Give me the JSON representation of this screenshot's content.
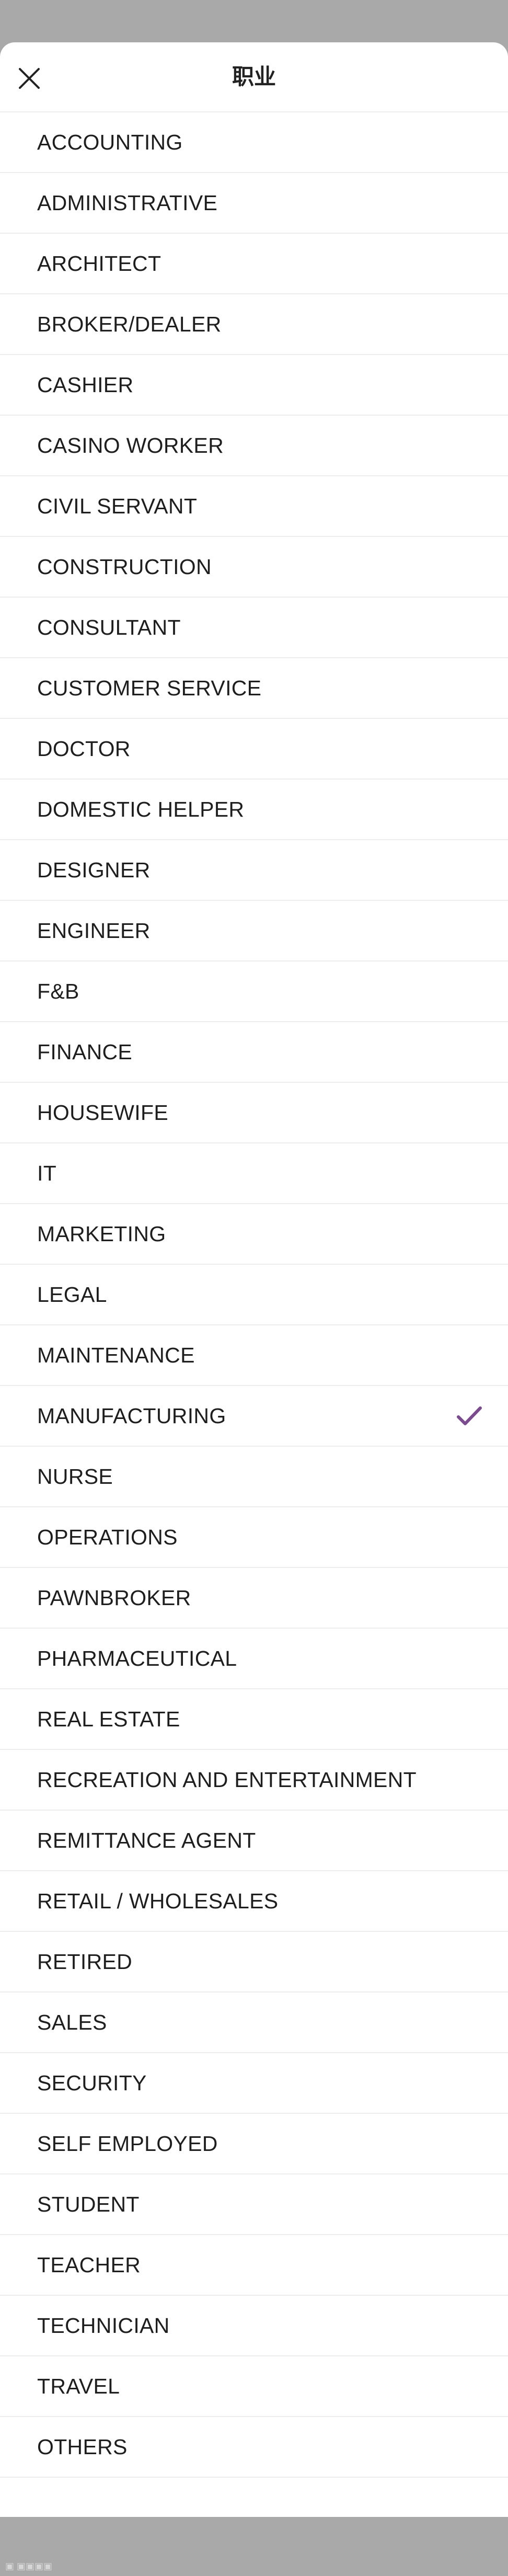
{
  "header": {
    "title": "职业",
    "close_icon": "close-icon"
  },
  "occupations": [
    {
      "label": "ACCOUNTING",
      "selected": false
    },
    {
      "label": "ADMINISTRATIVE",
      "selected": false
    },
    {
      "label": "ARCHITECT",
      "selected": false
    },
    {
      "label": "BROKER/DEALER",
      "selected": false
    },
    {
      "label": "CASHIER",
      "selected": false
    },
    {
      "label": "CASINO WORKER",
      "selected": false
    },
    {
      "label": "CIVIL SERVANT",
      "selected": false
    },
    {
      "label": "CONSTRUCTION",
      "selected": false
    },
    {
      "label": "CONSULTANT",
      "selected": false
    },
    {
      "label": "CUSTOMER SERVICE",
      "selected": false
    },
    {
      "label": "DOCTOR",
      "selected": false
    },
    {
      "label": "DOMESTIC HELPER",
      "selected": false
    },
    {
      "label": "DESIGNER",
      "selected": false
    },
    {
      "label": "ENGINEER",
      "selected": false
    },
    {
      "label": "F&B",
      "selected": false
    },
    {
      "label": "FINANCE",
      "selected": false
    },
    {
      "label": "HOUSEWIFE",
      "selected": false
    },
    {
      "label": "IT",
      "selected": false
    },
    {
      "label": "MARKETING",
      "selected": false
    },
    {
      "label": "LEGAL",
      "selected": false
    },
    {
      "label": "MAINTENANCE",
      "selected": false
    },
    {
      "label": "MANUFACTURING",
      "selected": true
    },
    {
      "label": "NURSE",
      "selected": false
    },
    {
      "label": "OPERATIONS",
      "selected": false
    },
    {
      "label": "PAWNBROKER",
      "selected": false
    },
    {
      "label": "PHARMACEUTICAL",
      "selected": false
    },
    {
      "label": "REAL ESTATE",
      "selected": false
    },
    {
      "label": "RECREATION AND ENTERTAINMENT",
      "selected": false
    },
    {
      "label": "REMITTANCE AGENT",
      "selected": false
    },
    {
      "label": "RETAIL / WHOLESALES",
      "selected": false
    },
    {
      "label": "RETIRED",
      "selected": false
    },
    {
      "label": "SALES",
      "selected": false
    },
    {
      "label": "SECURITY",
      "selected": false
    },
    {
      "label": "SELF EMPLOYED",
      "selected": false
    },
    {
      "label": "STUDENT",
      "selected": false
    },
    {
      "label": "TEACHER",
      "selected": false
    },
    {
      "label": "TECHNICIAN",
      "selected": false
    },
    {
      "label": "TRAVEL",
      "selected": false
    },
    {
      "label": "OTHERS",
      "selected": false
    }
  ],
  "colors": {
    "accent": "#7b4a8f",
    "overlay": "#a9a9a9",
    "divider": "#ededed"
  }
}
